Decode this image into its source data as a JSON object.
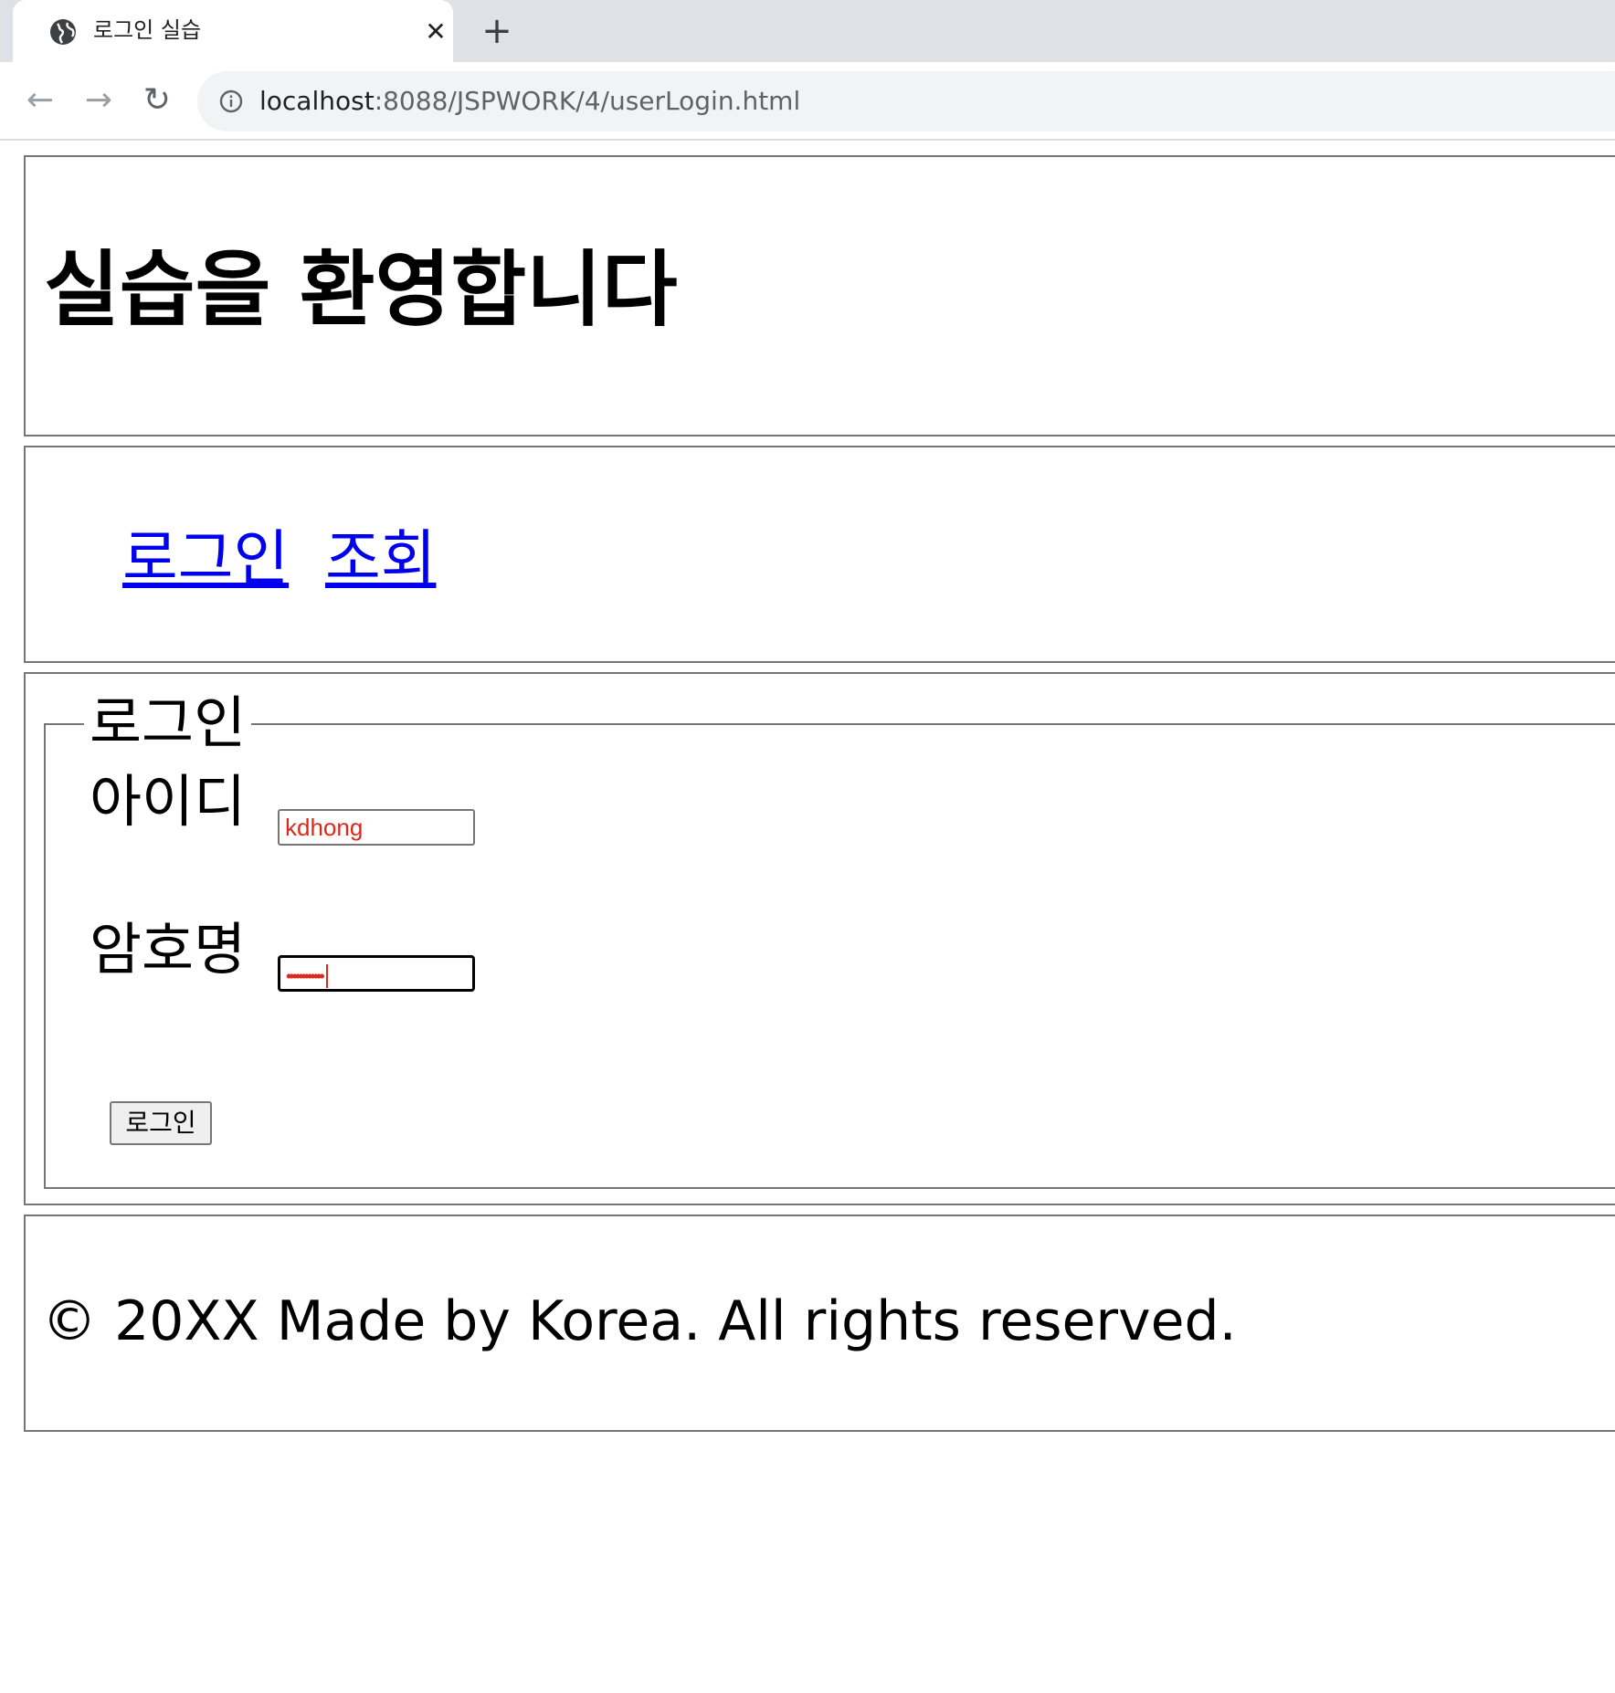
{
  "browser": {
    "tab": {
      "title": "로그인 실습",
      "close_glyph": "✕",
      "icon": "globe-icon"
    },
    "new_tab_glyph": "+",
    "nav": {
      "back_glyph": "←",
      "forward_glyph": "→",
      "reload_glyph": "↻"
    },
    "address": {
      "host": "localhost",
      "path": ":8088/JSPWORK/4/userLogin.html",
      "icon": "info-icon"
    }
  },
  "header": {
    "title": "실습을 환영합니다"
  },
  "nav": {
    "links": [
      {
        "label": "로그인"
      },
      {
        "label": "조회"
      }
    ]
  },
  "login_form": {
    "legend": "로그인",
    "id_label": "아이디",
    "id_value": "kdhong",
    "password_label": "암호명",
    "password_masked": "••••••••••••",
    "submit_label": "로그인"
  },
  "footer": {
    "text": "© 20XX Made by Korea. All rights reserved."
  },
  "colors": {
    "link": "#0000ee",
    "input_text": "#e0281a",
    "border": "#767676",
    "tabstrip": "#dee1e6"
  }
}
